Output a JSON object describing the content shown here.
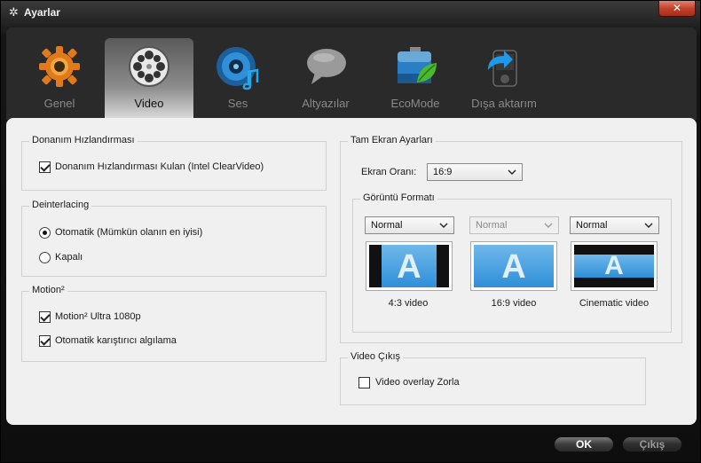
{
  "window": {
    "title": "Ayarlar",
    "close_label": "✕"
  },
  "tabs": [
    {
      "label": "Genel",
      "icon": "gear-icon"
    },
    {
      "label": "Video",
      "icon": "film-reel-icon",
      "active": true
    },
    {
      "label": "Ses",
      "icon": "speaker-icon"
    },
    {
      "label": "Altyazılar",
      "icon": "speech-bubble-icon"
    },
    {
      "label": "EcoMode",
      "icon": "battery-leaf-icon"
    },
    {
      "label": "Dışa aktarım",
      "icon": "export-device-icon"
    }
  ],
  "hw": {
    "title": "Donanım Hızlandırması",
    "checkbox_label": "Donanım Hızlandırması Kulan  (Intel ClearVideo)",
    "checked": true
  },
  "deinterlacing": {
    "title": "Deinterlacing",
    "options": [
      {
        "label": "Otomatik (Mümkün olanın en iyisi)",
        "selected": true
      },
      {
        "label": "Kapalı",
        "selected": false
      }
    ]
  },
  "motion": {
    "title": "Motion²",
    "items": [
      {
        "label": "Motion² Ultra 1080p",
        "checked": true
      },
      {
        "label": "Otomatik karıştırıcı algılama",
        "checked": true
      }
    ]
  },
  "fullscreen": {
    "title": "Tam Ekran Ayarları",
    "ratio_label": "Ekran Oranı:",
    "ratio_value": "16:9",
    "format": {
      "title": "Görüntü Formatı",
      "items": [
        {
          "select": "Normal",
          "enabled": true,
          "caption": "4:3 video"
        },
        {
          "select": "Normal",
          "enabled": false,
          "caption": "16:9 video"
        },
        {
          "select": "Normal",
          "enabled": true,
          "caption": "Cinematic video"
        }
      ]
    }
  },
  "video_out": {
    "title": "Video Çıkış",
    "checkbox_label": "Video overlay Zorla",
    "checked": false
  },
  "footer": {
    "ok_label": "OK",
    "cancel_label": "Çıkış"
  },
  "colors": {
    "panel": "#f0f0f0",
    "accent_blue": "#2f8fd8",
    "close_red": "#c1422c"
  }
}
